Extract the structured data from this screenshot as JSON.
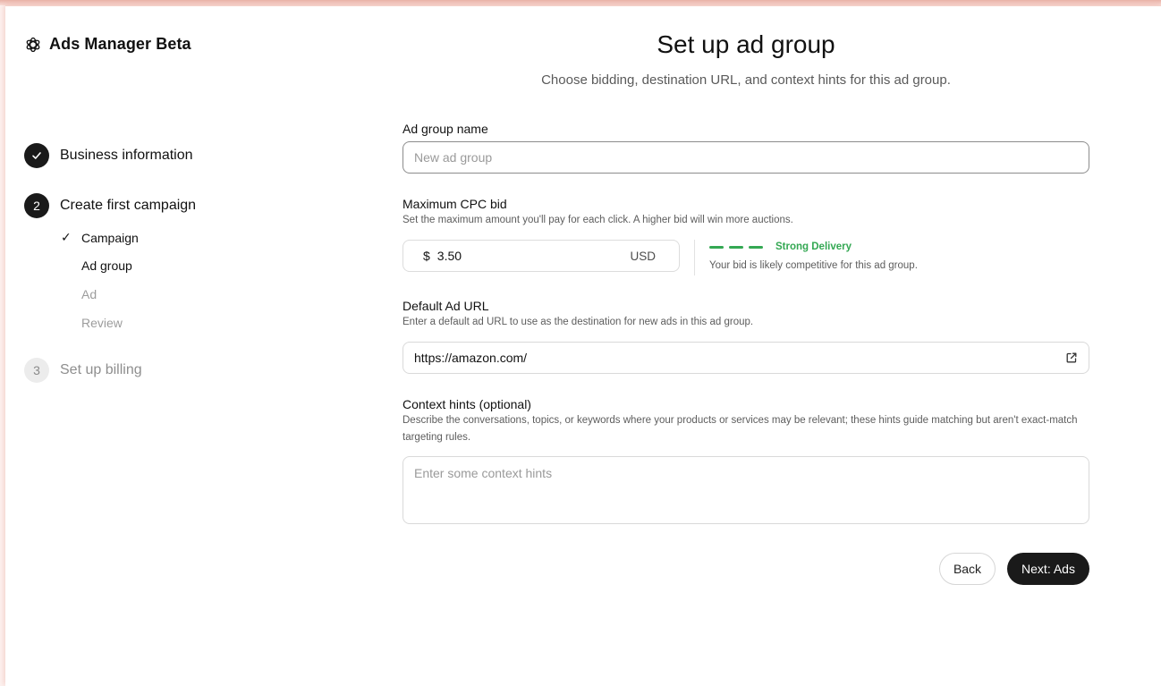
{
  "app": {
    "brand_name": "Ads Manager Beta",
    "brand_icon": "openai-logo-icon"
  },
  "sidebar": {
    "steps": [
      {
        "number": "",
        "label": "Business information",
        "state": "complete"
      },
      {
        "number": "2",
        "label": "Create first campaign",
        "state": "current"
      },
      {
        "number": "3",
        "label": "Set up billing",
        "state": "upcoming"
      }
    ],
    "substeps": [
      {
        "check": "✓",
        "label": "Campaign",
        "state": "complete"
      },
      {
        "check": "",
        "label": "Ad group",
        "state": "current"
      },
      {
        "check": "",
        "label": "Ad",
        "state": "upcoming"
      },
      {
        "check": "",
        "label": "Review",
        "state": "upcoming"
      }
    ]
  },
  "main": {
    "title": "Set up ad group",
    "subtitle": "Choose bidding, destination URL, and context hints for this ad group.",
    "ad_group_name": {
      "label": "Ad group name",
      "value": "",
      "placeholder": "New ad group"
    },
    "max_cpc": {
      "label": "Maximum CPC bid",
      "help": "Set the maximum amount you'll pay for each click. A higher bid will win more auctions.",
      "currency_symbol": "$",
      "value": "3.50",
      "currency": "USD",
      "strength_label": "Strong Delivery",
      "strength_level": 3,
      "strength_max": 3,
      "strength_color": "#34a853",
      "strength_help": "Your bid is likely competitive for this ad group."
    },
    "default_url": {
      "label": "Default Ad URL",
      "help": "Enter a default ad URL to use as the destination for new ads in this ad group.",
      "value": "https://amazon.com/",
      "icon": "external-link-icon"
    },
    "context_hints": {
      "label": "Context hints (optional)",
      "help": "Describe the conversations, topics, or keywords where your products or services may be relevant; these hints guide matching but aren't exact-match targeting rules.",
      "value": "",
      "placeholder": "Enter some context hints"
    },
    "buttons": {
      "back": "Back",
      "next": "Next: Ads"
    }
  },
  "colors": {
    "primary": "#1a1a1a",
    "success": "#34a853",
    "muted_text": "#8e8e8e"
  }
}
